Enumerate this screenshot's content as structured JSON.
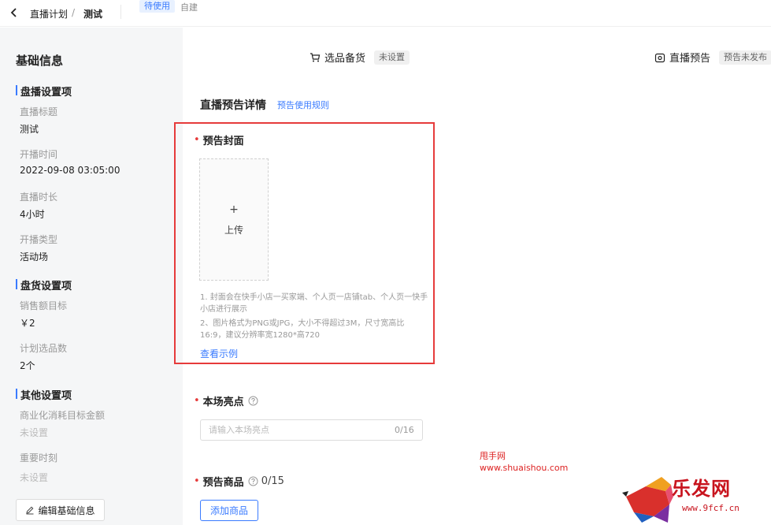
{
  "topbar": {
    "plan_label": "直播计划",
    "separator": "/",
    "current_label": "测试",
    "status_badge": "待使用",
    "source_tag": "自建"
  },
  "left": {
    "title": "基础信息",
    "sections": [
      {
        "heading": "盘播设置项",
        "fields": [
          {
            "label": "直播标题",
            "value": "测试"
          },
          {
            "label": "开播时间",
            "value": "2022-09-08 03:05:00"
          },
          {
            "label": "直播时长",
            "value": "4小时"
          },
          {
            "label": "开播类型",
            "value": "活动场"
          }
        ]
      },
      {
        "heading": "盘货设置项",
        "fields": [
          {
            "label": "销售额目标",
            "value": "￥2"
          },
          {
            "label": "计划选品数",
            "value": "2个"
          }
        ]
      },
      {
        "heading": "其他设置项",
        "fields": [
          {
            "label": "商业化消耗目标金额",
            "value": "未设置"
          },
          {
            "label": "重要时刻",
            "value": "未设置"
          }
        ]
      }
    ],
    "edit_button": "编辑基础信息"
  },
  "tabs": {
    "selection_label": "选品备货",
    "selection_status": "未设置",
    "preview_label": "直播预告",
    "preview_status": "预告未发布"
  },
  "form": {
    "title": "直播预告详情",
    "rule_link": "预告使用规则",
    "cover": {
      "required_mark": "•",
      "label": "预告封面",
      "upload_plus": "+",
      "upload_text": "上传",
      "hint_1": "1. 封面会在快手小店一买家端、个人页一店铺tab、个人页一快手小店进行展示",
      "hint_2": "2、图片格式为PNG或JPG，大小不得超过3M，尺寸宽高比16:9，建议分辨率宽1280*高720",
      "example_link": "查看示例"
    },
    "highlights": {
      "required_mark": "•",
      "label": "本场亮点",
      "placeholder": "请输入本场亮点",
      "counter": "0/16"
    },
    "products": {
      "required_mark": "•",
      "label": "预告商品",
      "counter": "0/15",
      "add_button": "添加商品"
    }
  },
  "watermark": {
    "line1": "甩手网",
    "line2": "www.shuaishou.com",
    "logo_text": "乐发网",
    "logo_url": "www.9fcf.cn"
  },
  "colors": {
    "accent": "#3a7bff",
    "highlight_border": "#e63b3b",
    "required": "#e63b3b",
    "panel_bg": "#f5f6f7"
  },
  "icons": {
    "back": "chevron-left-icon",
    "edit": "pencil-icon",
    "cart": "cart-icon",
    "camera": "camera-icon",
    "help": "question-circle-icon"
  }
}
